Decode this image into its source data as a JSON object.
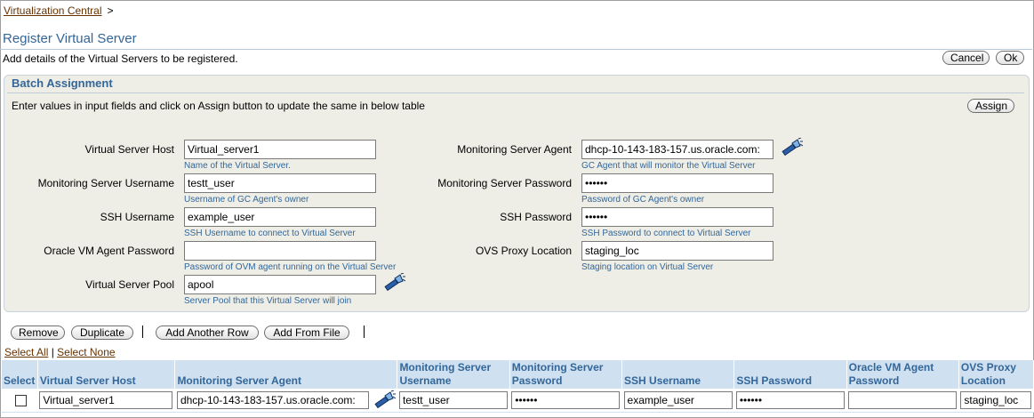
{
  "breadcrumb": {
    "link": "Virtualization Central",
    "sep": ">"
  },
  "page": {
    "title": "Register Virtual Server",
    "description": "Add details of the Virtual Servers to be registered.",
    "cancel_label": "Cancel",
    "ok_label": "Ok"
  },
  "batch": {
    "title": "Batch Assignment",
    "instructions": "Enter values in input fields and click on Assign button to update the same in below table",
    "assign_label": "Assign",
    "fields": {
      "vs_host": {
        "label": "Virtual Server Host",
        "value": "Virtual_server1",
        "hint": "Name of the Virtual Server."
      },
      "mon_user": {
        "label": "Monitoring Server Username",
        "value": "testt_user",
        "hint": "Username of GC Agent's owner"
      },
      "ssh_user": {
        "label": "SSH Username",
        "value": "example_user",
        "hint": "SSH Username to connect to Virtual Server"
      },
      "ovm_pwd": {
        "label": "Oracle VM Agent Password",
        "value": "",
        "hint": "Password of OVM agent running on the Virtual Server"
      },
      "vs_pool": {
        "label": "Virtual Server Pool",
        "value": "apool",
        "hint": "Server Pool that this Virtual Server will join"
      },
      "mon_agent": {
        "label": "Monitoring Server Agent",
        "value": "dhcp-10-143-183-157.us.oracle.com:",
        "hint": "GC Agent that will monitor the Virtual Server"
      },
      "mon_pwd": {
        "label": "Monitoring Server Password",
        "value": "••••••",
        "hint": "Password of GC Agent's owner"
      },
      "ssh_pwd": {
        "label": "SSH Password",
        "value": "••••••",
        "hint": "SSH Password to connect to Virtual Server"
      },
      "ovs_proxy": {
        "label": "OVS Proxy Location",
        "value": "staging_loc",
        "hint": "Staging location on Virtual Server"
      }
    }
  },
  "toolbar": {
    "remove_label": "Remove",
    "duplicate_label": "Duplicate",
    "add_row_label": "Add Another Row",
    "add_file_label": "Add From File",
    "select_all": "Select All",
    "select_sep": "|",
    "select_none": "Select None"
  },
  "table": {
    "headers": [
      "Select",
      "Virtual Server Host",
      "Monitoring Server Agent",
      "Monitoring Server Username",
      "Monitoring Server Password",
      "SSH Username",
      "SSH Password",
      "Oracle VM Agent Password",
      "OVS Proxy Location"
    ],
    "row": {
      "vs_host": "Virtual_server1",
      "mon_agent": "dhcp-10-143-183-157.us.oracle.com:",
      "mon_user": "testt_user",
      "mon_pwd": "••••••",
      "ssh_user": "example_user",
      "ssh_pwd": "••••••",
      "ovm_pwd": "",
      "ovs_proxy": "staging_loc"
    }
  },
  "icons": {
    "search": "flashlight-search-icon"
  },
  "colors": {
    "accent": "#336699",
    "link": "#663300",
    "header_bg": "#cfe0f1",
    "section_bg": "#eeeee6"
  }
}
